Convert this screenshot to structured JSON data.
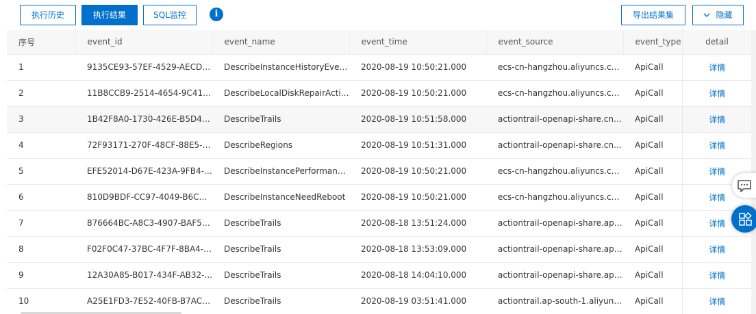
{
  "toolbar": {
    "history_label": "执行历史",
    "results_label": "执行结果",
    "sql_monitor_label": "SQL监控",
    "info_glyph": "i",
    "export_label": "导出结果集",
    "hide_label": "隐藏"
  },
  "table": {
    "columns": [
      "序号",
      "event_id",
      "event_name",
      "event_time",
      "event_source",
      "event_type",
      "detail"
    ],
    "rows": [
      {
        "index": "1",
        "event_id": "9135CE93-57EF-4529-AECD-...",
        "event_name": "DescribeInstanceHistoryEvents",
        "event_time": "2020-08-19 10:50:21.000",
        "event_source": "ecs-cn-hangzhou.aliyuncs.com",
        "event_type": "ApiCall",
        "detail": "详情"
      },
      {
        "index": "2",
        "event_id": "11B8CCB9-2514-4654-9C41-...",
        "event_name": "DescribeLocalDiskRepairActivi...",
        "event_time": "2020-08-19 10:50:21.000",
        "event_source": "ecs-cn-hangzhou.aliyuncs.com",
        "event_type": "ApiCall",
        "detail": "详情"
      },
      {
        "index": "3",
        "event_id": "1B42F8A0-1730-426E-B5D4-3...",
        "event_name": "DescribeTrails",
        "event_time": "2020-08-19 10:51:58.000",
        "event_source": "actiontrail-openapi-share.cn-...",
        "event_type": "ApiCall",
        "detail": "详情"
      },
      {
        "index": "4",
        "event_id": "72F93171-270F-48CF-88E5-E...",
        "event_name": "DescribeRegions",
        "event_time": "2020-08-19 10:51:31.000",
        "event_source": "actiontrail-openapi-share.cn-...",
        "event_type": "ApiCall",
        "detail": "详情"
      },
      {
        "index": "5",
        "event_id": "EFE52014-D67E-423A-9FB4-3...",
        "event_name": "DescribeInstancePerformance...",
        "event_time": "2020-08-19 10:50:21.000",
        "event_source": "ecs-cn-hangzhou.aliyuncs.com",
        "event_type": "ApiCall",
        "detail": "详情"
      },
      {
        "index": "6",
        "event_id": "810D9BDF-CC97-4049-B6C4-...",
        "event_name": "DescribeInstanceNeedReboot",
        "event_time": "2020-08-19 10:50:21.000",
        "event_source": "ecs-cn-hangzhou.aliyuncs.com",
        "event_type": "ApiCall",
        "detail": "详情"
      },
      {
        "index": "7",
        "event_id": "876664BC-A8C3-4907-BAF5-...",
        "event_name": "DescribeTrails",
        "event_time": "2020-08-18 13:51:24.000",
        "event_source": "actiontrail-openapi-share.ap-...",
        "event_type": "ApiCall",
        "detail": "详情"
      },
      {
        "index": "8",
        "event_id": "F02F0C47-37BC-4F7F-8BA4-2...",
        "event_name": "DescribeTrails",
        "event_time": "2020-08-18 13:53:09.000",
        "event_source": "actiontrail-openapi-share.ap-...",
        "event_type": "ApiCall",
        "detail": "详情"
      },
      {
        "index": "9",
        "event_id": "12A30A85-B017-434F-AB32-...",
        "event_name": "DescribeTrails",
        "event_time": "2020-08-18 14:04:10.000",
        "event_source": "actiontrail-openapi-share.ap-...",
        "event_type": "ApiCall",
        "detail": "详情"
      },
      {
        "index": "10",
        "event_id": "A25E1FD3-7E52-40FB-B7AC-...",
        "event_name": "DescribeTrails",
        "event_time": "2020-08-19 03:51:41.000",
        "event_source": "actiontrail.ap-south-1.aliyunc...",
        "event_type": "ApiCall",
        "detail": "详情"
      }
    ],
    "highlighted_row": 2
  },
  "float_buttons": {
    "chat_icon": "chat-bubble-icon",
    "apps_icon": "apps-grid-icon"
  },
  "colors": {
    "accent": "#0070cc",
    "header_bg": "#f7f7f7",
    "border": "#e8e8e8"
  }
}
